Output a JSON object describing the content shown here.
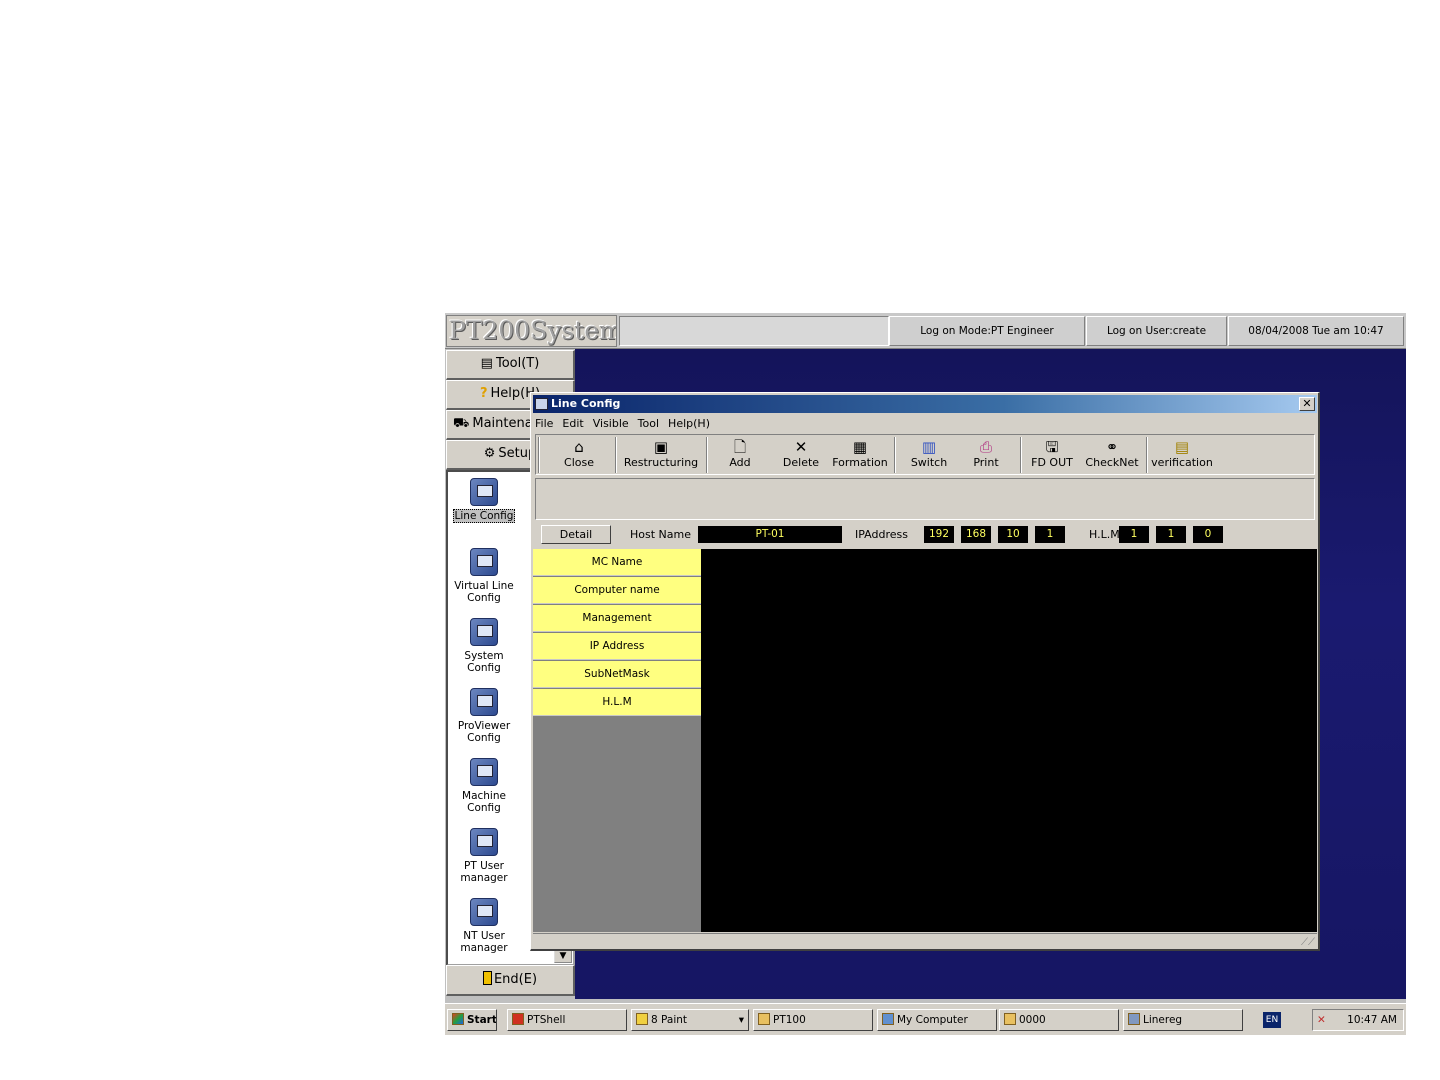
{
  "header": {
    "logo": "PT200System",
    "logon_mode": "Log on Mode:PT Engineer",
    "logon_user": "Log on User:create",
    "datetime": "08/04/2008 Tue am 10:47"
  },
  "left_menu": {
    "tool": "Tool(T)",
    "help": "Help(H)",
    "maintenance": "Maintenar",
    "setup": "Setup",
    "end": "End(E)",
    "items": [
      {
        "label": "Line Config",
        "icon": "line-config-icon"
      },
      {
        "label": "Virtual Line Config",
        "icon": "virtual-line-config-icon"
      },
      {
        "label": "System Config",
        "icon": "system-config-icon"
      },
      {
        "label": "ProViewer Config",
        "icon": "proviewer-config-icon"
      },
      {
        "label": "Machine Config",
        "icon": "machine-config-icon"
      },
      {
        "label": "PT User manager",
        "icon": "pt-user-manager-icon"
      },
      {
        "label": "NT User manager",
        "icon": "nt-user-manager-icon"
      }
    ]
  },
  "dialog": {
    "title": "Line Config",
    "menu": [
      "File",
      "Edit",
      "Visible",
      "Tool",
      "Help(H)"
    ],
    "toolbar": [
      "Close",
      "Restructuring",
      "Add",
      "Delete",
      "Formation",
      "Switch",
      "Print",
      "FD OUT",
      "CheckNet",
      "verification"
    ],
    "detail_button": "Detail",
    "host_name_label": "Host Name",
    "host_name_value": "PT-01",
    "ip_label": "IPAddress",
    "ip": [
      "192",
      "168",
      "10",
      "1"
    ],
    "hlm_label": "H.L.M",
    "hlm": [
      "1",
      "1",
      "0"
    ],
    "rows": [
      "MC Name",
      "Computer name",
      "Management",
      "IP Address",
      "SubNetMask",
      "H.L.M"
    ]
  },
  "taskbar": {
    "start": "Start",
    "tasks": [
      "PTShell",
      "8 Paint",
      "PT100",
      "My Computer",
      "0000",
      "Linereg"
    ],
    "lang": "EN",
    "clock": "10:47 AM"
  }
}
